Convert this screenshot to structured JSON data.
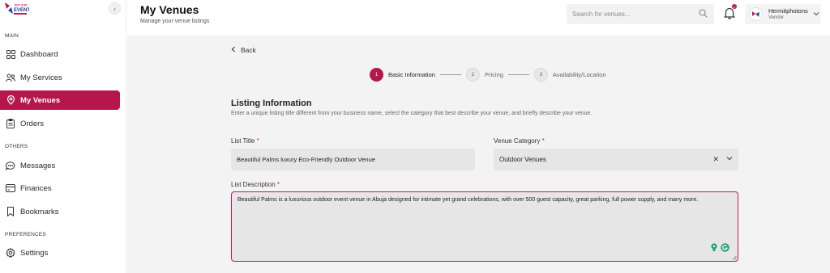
{
  "sidebar": {
    "logo_text": "NOT JUST EVENT",
    "sections": {
      "main": "MAIN",
      "others": "OTHERS",
      "preferences": "PREFERENCES"
    },
    "items": [
      {
        "label": "Dashboard",
        "icon": "grid-icon"
      },
      {
        "label": "My Services",
        "icon": "people-icon"
      },
      {
        "label": "My Venues",
        "icon": "location-pin-icon",
        "active": true
      },
      {
        "label": "Orders",
        "icon": "clipboard-icon"
      },
      {
        "label": "Messages",
        "icon": "chat-icon"
      },
      {
        "label": "Finances",
        "icon": "card-icon"
      },
      {
        "label": "Bookmarks",
        "icon": "bookmark-icon"
      },
      {
        "label": "Settings",
        "icon": "gear-icon"
      }
    ]
  },
  "header": {
    "title": "My Venues",
    "subtitle": "Manage your venue listings",
    "search_placeholder": "Search for venues...",
    "notification_count": "1",
    "user_name": "Hermitphotons",
    "user_role": "Vendor"
  },
  "main": {
    "back_label": "Back",
    "steps": [
      {
        "number": "1",
        "label": "Basic Information",
        "active": true
      },
      {
        "number": "2",
        "label": "Pricing",
        "active": false
      },
      {
        "number": "3",
        "label": "Availability/Location",
        "active": false
      }
    ],
    "section_title": "Listing Information",
    "section_desc": "Enter a unique listing title different from your business name, select the category that best describe your venue, and briefly describe your venue.",
    "list_title_label": "List Title",
    "list_title_value": "Beautiful Palms luxury Eco-Friendly Outdoor Venue",
    "venue_category_label": "Venue Category",
    "venue_category_value": "Outdoor Venues",
    "list_description_label": "List Description",
    "list_description_value": "Beautiful Palms is a luxurious outdoor event venue in Abuja designed for intimate yet grand celebrations, with over 500 guest capacity, great parking, full power supply, and many more.",
    "required_marker": "*"
  },
  "colors": {
    "accent": "#b5174a",
    "required": "#c2185b",
    "main_bg": "#f3f3f3",
    "input_bg": "#e6e6e6"
  }
}
